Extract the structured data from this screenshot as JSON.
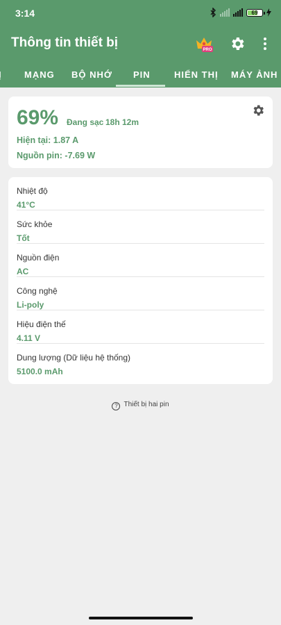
{
  "status": {
    "time": "3:14",
    "battery_level": "69",
    "icons": [
      "bluetooth-icon",
      "signal-weak-icon",
      "signal-icon",
      "battery-icon",
      "charging-bolt-icon"
    ]
  },
  "appbar": {
    "title": "Thông tin thiết bị",
    "pro_badge": "PRO",
    "icons": [
      "crown-pro-icon",
      "settings-gear-icon",
      "more-vert-icon"
    ],
    "color": "#5a9a6c"
  },
  "tabs": [
    {
      "label": "Ị"
    },
    {
      "label": "MẠNG"
    },
    {
      "label": "BỘ NHỚ"
    },
    {
      "label": "PIN",
      "active": true
    },
    {
      "label": "HIỂN THỊ"
    },
    {
      "label": "MÁY ẢNH"
    }
  ],
  "battery": {
    "percent": "69%",
    "charging_label": "Đang sạc",
    "remaining": "18h 12m",
    "current": "Hiện tại: 1.87 A",
    "power": "Nguồn pin: -7.69 W"
  },
  "details": [
    {
      "label": "Nhiệt độ",
      "value": "41°C"
    },
    {
      "label": "Sức khỏe",
      "value": "Tốt"
    },
    {
      "label": "Nguồn điện",
      "value": "AC"
    },
    {
      "label": "Công nghệ",
      "value": "Li-poly"
    },
    {
      "label": "Hiệu điện thế",
      "value": "4.11 V"
    },
    {
      "label": "Dung lượng (Dữ liệu hệ thống)",
      "value": "5100.0 mAh"
    }
  ],
  "dual_battery": {
    "icon": "question-circle-icon",
    "label": "Thiết bị hai pin"
  }
}
